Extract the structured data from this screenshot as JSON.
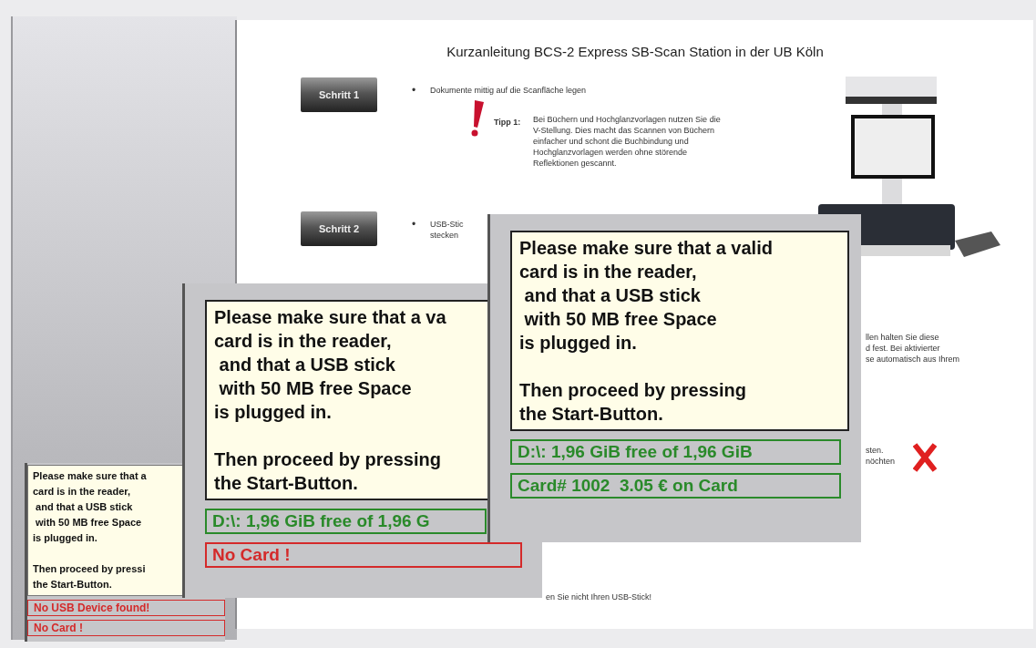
{
  "document": {
    "title": "Kurzanleitung BCS-2 Express SB-Scan Station in der UB Köln",
    "steps": [
      {
        "label": "Schritt 1",
        "bullet": "•",
        "lines": [
          "Dokumente mittig auf die Scanfläche legen"
        ],
        "tip": {
          "label": "Tipp 1:",
          "lines": [
            "Bei Büchern und Hochglanzvorlagen nutzen Sie die",
            "V-Stellung. Dies macht das Scannen von Büchern",
            "einfacher und schont die Buchbindung und",
            "Hochglanzvorlagen werden ohne störende",
            "Reflektionen gescannt."
          ]
        }
      },
      {
        "label": "Schritt 2",
        "bullet": "•",
        "lines": [
          "USB-Stic",
          "stecken"
        ]
      }
    ],
    "fragments": [
      {
        "lines": [
          "llen halten Sie diese",
          "d fest. Bei aktivierter",
          "se automatisch aus Ihrem"
        ],
        "cross": false
      },
      {
        "lines": [
          "sten.",
          "nöchten"
        ],
        "cross": true
      },
      {
        "lines": [
          "en Sie nicht Ihren USB-Stick!"
        ],
        "cross": false
      }
    ]
  },
  "panels": [
    {
      "message": [
        [
          "Please make sure that a",
          "card is in the reader,",
          " and that a USB stick",
          " with 50 MB free Space",
          "is plugged in."
        ],
        [
          "Then proceed by pressi",
          "the Start-Button."
        ]
      ],
      "status": [
        {
          "text": "No USB Device found!",
          "kind": "error"
        },
        {
          "text": "No Card !",
          "kind": "error"
        }
      ]
    },
    {
      "message": [
        [
          "Please make sure that a va",
          "card is in the reader,",
          " and that a USB stick",
          " with 50 MB free Space",
          "is plugged in."
        ],
        [
          "Then proceed by pressing",
          "the Start-Button."
        ]
      ],
      "status": [
        {
          "text": "D:\\: 1,96 GiB free of 1,96 G",
          "kind": "ok"
        },
        {
          "text": "No Card !",
          "kind": "error"
        }
      ]
    },
    {
      "message": [
        [
          "Please make sure that a valid",
          "card is in the reader,",
          " and that a USB stick",
          " with 50 MB free Space",
          "is plugged in."
        ],
        [
          "Then proceed by pressing",
          "the Start-Button."
        ]
      ],
      "status": [
        {
          "text": "D:\\: 1,96 GiB free of 1,96 GiB",
          "kind": "ok"
        },
        {
          "text": "Card# 1002  3.05 € on Card",
          "kind": "ok"
        }
      ]
    }
  ]
}
